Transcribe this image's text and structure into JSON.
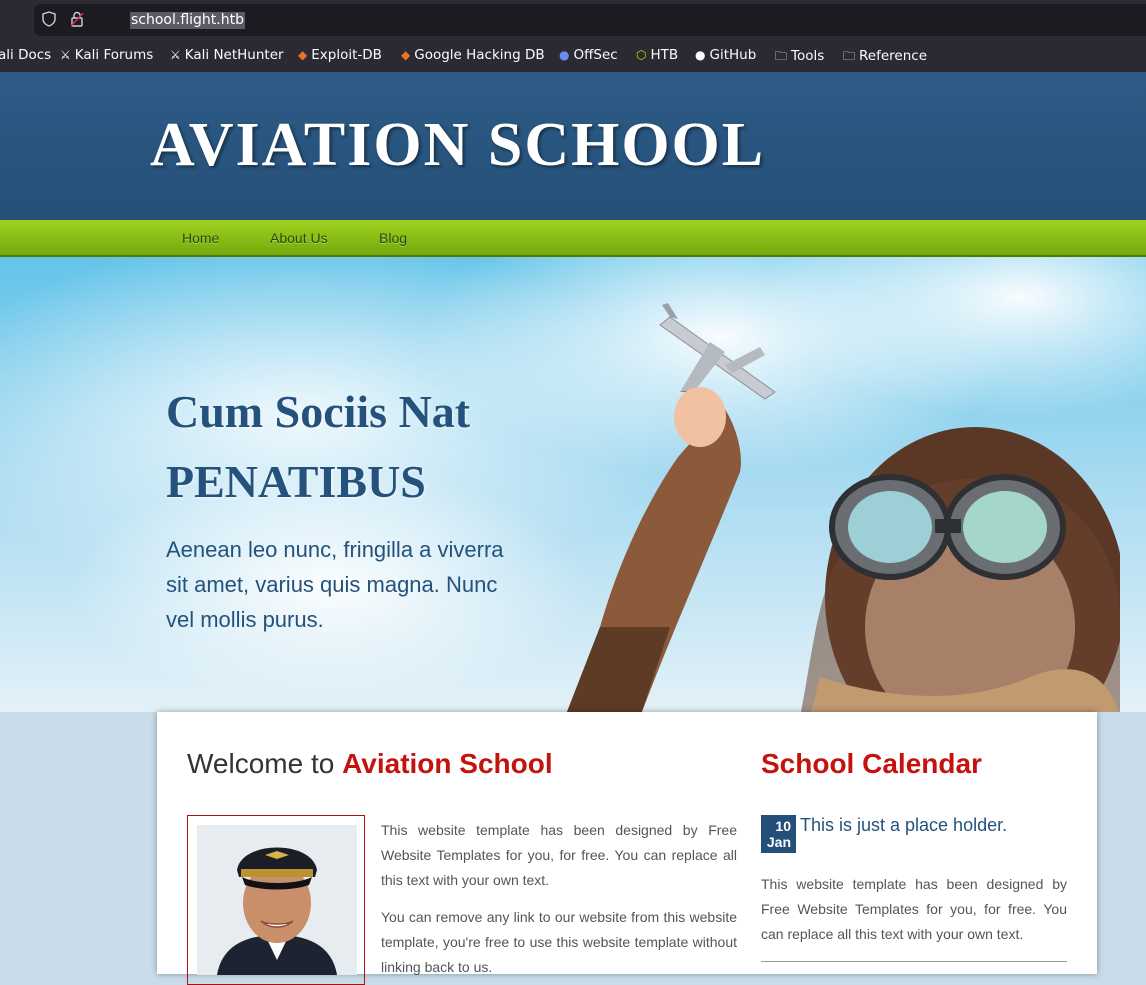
{
  "browser": {
    "url": "school.flight.htb",
    "bookmarks": [
      {
        "label": "ali Docs",
        "icon": "kali-icon"
      },
      {
        "label": "Kali Forums",
        "icon": "kali-icon"
      },
      {
        "label": "Kali NetHunter",
        "icon": "kali-icon"
      },
      {
        "label": "Exploit-DB",
        "icon": "exploitdb-icon"
      },
      {
        "label": "Google Hacking DB",
        "icon": "exploitdb-icon"
      },
      {
        "label": "OffSec",
        "icon": "offsec-icon"
      },
      {
        "label": "HTB",
        "icon": "htb-icon"
      },
      {
        "label": "GitHub",
        "icon": "github-icon"
      },
      {
        "label": "Tools",
        "icon": "folder-icon"
      },
      {
        "label": "Reference",
        "icon": "folder-icon"
      }
    ]
  },
  "site": {
    "logo": "AVIATION SCHOOL",
    "nav": [
      "Home",
      "About Us",
      "Blog"
    ]
  },
  "hero": {
    "title_line1": "Cum Sociis Nat",
    "title_line2": "PENATIBUS",
    "text": "Aenean leo nunc, fringilla a viverra sit amet, varius quis magna. Nunc vel mollis purus."
  },
  "welcome": {
    "prefix": "Welcome to ",
    "accent": "Aviation School",
    "para1": "This website template has been designed by Free Website Templates for you, for free. You can replace all this text with your own text.",
    "para2": "You can remove any link to our website from this website template, you're free to use this website template without linking back to us."
  },
  "calendar": {
    "title": "School Calendar",
    "day": "10",
    "month": "Jan",
    "event_title": "This is just a place holder.",
    "event_text": "This website template has been designed by Free Website Templates for you, for free. You can replace all this text with your own text."
  },
  "colors": {
    "header_blue": "#244f78",
    "nav_green": "#8cc21a",
    "accent_red": "#c4120f"
  }
}
